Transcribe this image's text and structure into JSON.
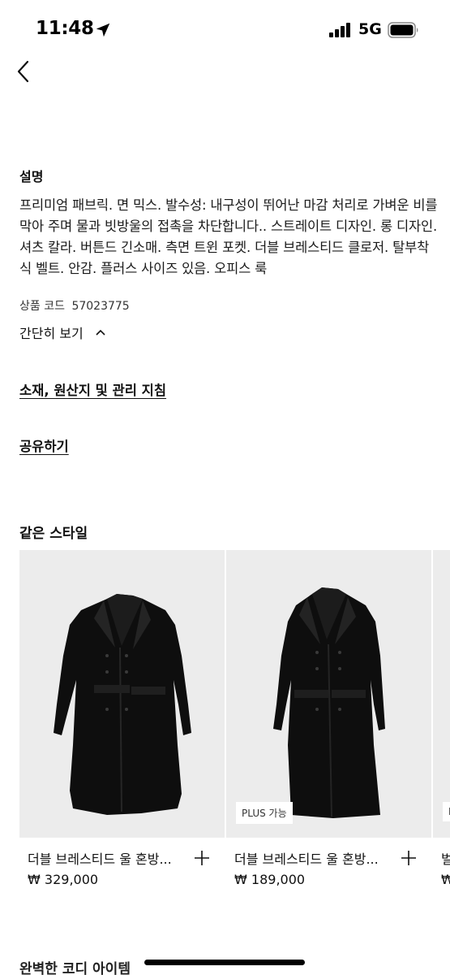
{
  "status_bar": {
    "time": "11:48",
    "network": "5G"
  },
  "description": {
    "heading": "설명",
    "body": "프리미엄 패브릭. 면 믹스. 발수성: 내구성이 뛰어난 마감 처리로 가벼운 비를 막아 주며 물과 빗방울의 접촉을 차단합니다.. 스트레이트 디자인. 롱 디자인. 셔츠 칼라. 버튼드 긴소매. 측면 트윈 포켓. 더블 브레스티드 클로저. 탈부착식 벨트. 안감. 플러스 사이즈 있음. 오피스 룩",
    "product_code_label": "상품 코드",
    "product_code": "57023775",
    "collapse_label": "간단히 보기"
  },
  "links": {
    "material": "소재, 원산지 및 관리 지침",
    "share": "공유하기"
  },
  "same_style": {
    "heading": "같은 스타일",
    "items": [
      {
        "title": "더블 브레스티드 울 혼방...",
        "price": "₩ 329,000",
        "badge": ""
      },
      {
        "title": "더블 브레스티드 울 혼방...",
        "price": "₩ 189,000",
        "badge": "PLUS 가능"
      },
      {
        "title": "벌",
        "price": "₩",
        "badge": "P"
      }
    ]
  },
  "next_section": {
    "heading": "완벽한 코디 아이템"
  }
}
